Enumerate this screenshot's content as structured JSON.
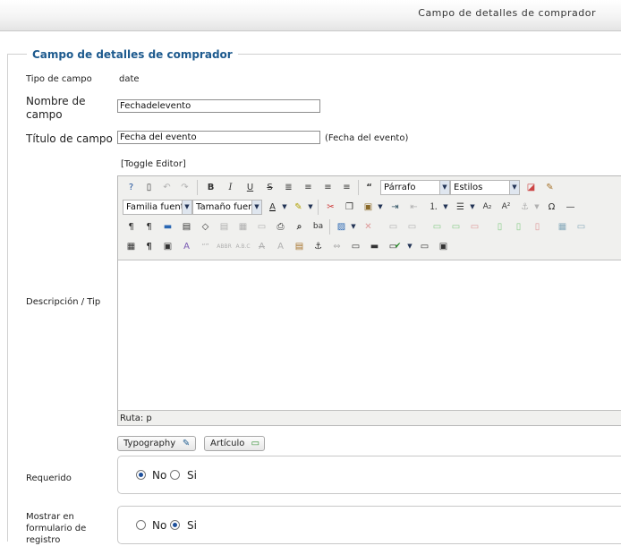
{
  "header": {
    "title": "Campo de detalles de comprador"
  },
  "fieldset": {
    "legend": "Campo de detalles de comprador"
  },
  "fields": {
    "tipo_label": "Tipo de campo",
    "tipo_value": "date",
    "nombre_label": "Nombre de campo",
    "nombre_value": "Fechadelevento",
    "titulo_label": "Título de campo",
    "titulo_value": "Fecha del evento",
    "titulo_hint": "(Fecha del evento)",
    "descripcion_label": "Descripción / Tip",
    "requerido_label": "Requerido",
    "mostrar_label": "Mostrar en formulario de registro"
  },
  "editor": {
    "toggle": "[Toggle Editor]",
    "format_select": "Párrafo",
    "styles_select": "Estilos",
    "font_family_select": "Familia fuente",
    "font_size_select": "Tamaño fuente",
    "path": "Ruta: p",
    "toolbar_icons": {
      "row1": [
        "help-icon",
        "new-document-icon",
        "undo-icon",
        "redo-icon",
        "bold-icon",
        "italic-icon",
        "underline-icon",
        "strikethrough-icon",
        "align-justify-icon",
        "align-center-icon",
        "align-left-icon",
        "align-right-icon",
        "blockquote-icon",
        "eraser-icon",
        "cleanup-broom-icon"
      ],
      "row2": [
        "font-color-icon",
        "highlight-icon",
        "cut-icon",
        "copy-icon",
        "paste-icon",
        "indent-icon",
        "outdent-icon",
        "ordered-list-icon",
        "unordered-list-icon",
        "subscript-icon",
        "superscript-icon",
        "anchor-icon",
        "special-character-icon",
        "horizontal-rule-icon"
      ],
      "row3": [
        "ltr-icon",
        "rtl-icon",
        "media-icon",
        "template-icon",
        "code-icon",
        "paste-text-icon",
        "paste-word-icon",
        "select-all-icon",
        "print-icon",
        "search-icon",
        "replace-icon",
        "insert-image-icon",
        "unlink-icon",
        "row-before-icon",
        "row-after-icon",
        "delete-row-icon",
        "col-before-icon",
        "col-after-icon",
        "delete-col-icon",
        "table-icon",
        "merge-cells-icon"
      ],
      "row4": [
        "visual-aid-icon",
        "pilcrow-icon",
        "fullscreen-icon",
        "abbr-icon",
        "cite-icon",
        "acronym-icon",
        "ins-icon",
        "del-icon",
        "style-props-icon",
        "attributes-icon",
        "layer-icon",
        "absolute-icon",
        "nonbreaking-icon",
        "image-icon",
        "link-icon",
        "spellcheck-icon",
        "pagebreak-icon",
        "preview-icon"
      ]
    }
  },
  "buttons": {
    "typography": "Typography",
    "articulo": "Artículo"
  },
  "requerido": {
    "no": "No",
    "si": "Si",
    "selected": "no"
  },
  "mostrar": {
    "no": "No",
    "si": "Si",
    "selected": "si"
  }
}
